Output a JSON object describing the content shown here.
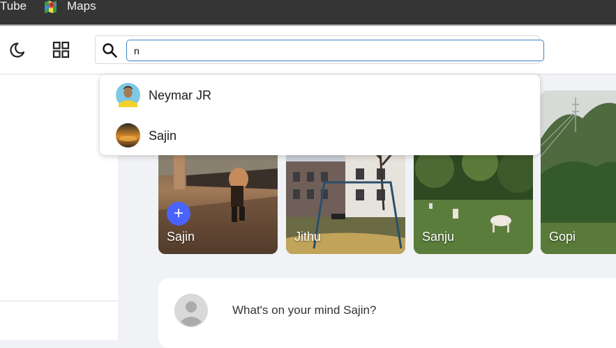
{
  "bookmarks": {
    "items": [
      {
        "label": "Tube"
      },
      {
        "label": "Maps",
        "icon": "google-maps-icon"
      }
    ]
  },
  "header": {
    "theme_icon": "moon-icon",
    "apps_icon": "grid-icon",
    "search": {
      "icon": "search-icon",
      "value": "n"
    }
  },
  "search_results": [
    {
      "name": "Neymar JR",
      "avatar": "avatar-neymar"
    },
    {
      "name": "Sajin",
      "avatar": "avatar-sajin"
    }
  ],
  "stories": [
    {
      "name": "Sajin",
      "add_label": "+"
    },
    {
      "name": "Jithu"
    },
    {
      "name": "Sanju"
    },
    {
      "name": "Gopi"
    }
  ],
  "composer": {
    "placeholder": "What's on your mind Sajin?"
  },
  "colors": {
    "accent": "#4a63ff",
    "search_focus": "#3b82c4",
    "bookmarks_bg": "#353535"
  }
}
